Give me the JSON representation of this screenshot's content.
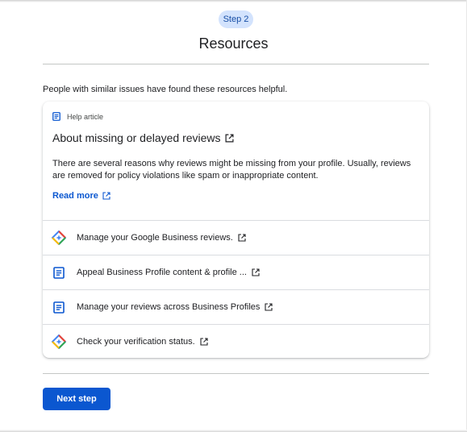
{
  "step": {
    "label": "Step 2"
  },
  "page": {
    "title": "Resources"
  },
  "intro": "People with similar issues have found these resources helpful.",
  "article": {
    "type_label": "Help article",
    "title": "About missing or delayed reviews",
    "body": "There are several reasons why reviews might be missing from your profile. Usually, reviews are removed for policy violations like spam or inappropriate content.",
    "read_more": "Read more"
  },
  "resources": [
    {
      "label": "Manage your Google Business reviews.",
      "icon": "google-business-diamond-icon"
    },
    {
      "label": "Appeal Business Profile content & profile ...",
      "icon": "document-icon"
    },
    {
      "label": "Manage your reviews across Business Profiles",
      "icon": "document-icon"
    },
    {
      "label": "Check your verification status.",
      "icon": "google-business-diamond-icon"
    }
  ],
  "actions": {
    "next_step": "Next step"
  },
  "colors": {
    "accent": "#0b57d0",
    "chip_bg": "#d3e3fd",
    "divider": "#c4c7c5"
  }
}
